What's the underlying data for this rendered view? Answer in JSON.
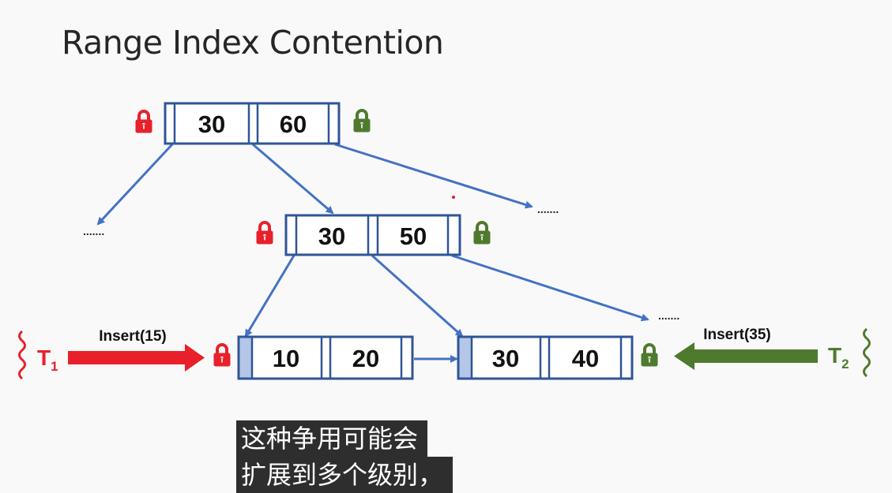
{
  "slide": {
    "title": "Range Index Contention"
  },
  "colors": {
    "node_border": "#2f5597",
    "arrow": "#4472c4",
    "lock_red": "#e8202a",
    "lock_green": "#4e7a2e",
    "t1_red": "#e8202a",
    "t2_green": "#4e7a2e",
    "pointer_fill": "#b4c7e7"
  },
  "tree": {
    "root": {
      "keys": [
        "30",
        "60"
      ]
    },
    "middle": {
      "keys": [
        "30",
        "50"
      ]
    },
    "leaf_left": {
      "keys": [
        "10",
        "20"
      ]
    },
    "leaf_right": {
      "keys": [
        "30",
        "40"
      ]
    },
    "ellipsis_left": ".......",
    "ellipsis_right": ".......",
    "ellipsis_leaf": "......."
  },
  "transactions": {
    "t1": {
      "letter": "T",
      "sub": "1",
      "action": "Insert(15)"
    },
    "t2": {
      "letter": "T",
      "sub": "2",
      "action": "Insert(35)"
    }
  },
  "locks": {
    "root_left": "lock-red",
    "root_right": "lock-green",
    "mid_left": "lock-red",
    "mid_right": "lock-green",
    "leaf_left": "lock-red",
    "leaf_right": "lock-green"
  },
  "caption": {
    "line1": "这种争用可能会",
    "line2": "扩展到多个级别，"
  }
}
